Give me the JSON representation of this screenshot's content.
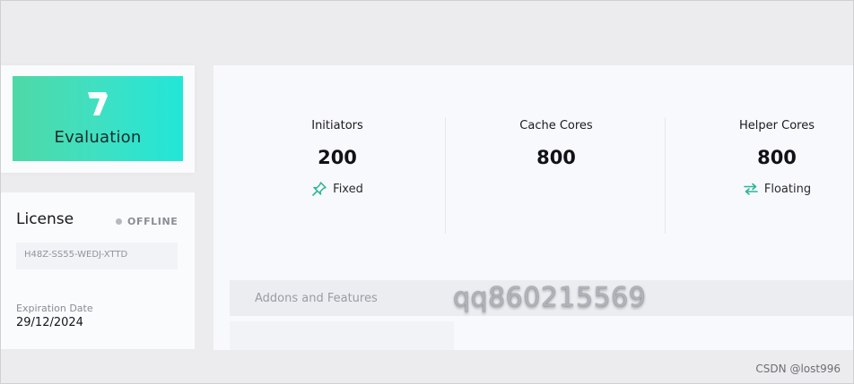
{
  "brand": {
    "title": "Evaluation",
    "logo_icon": "brand-logo-icon",
    "gradient": [
      "#4fd8a6",
      "#22e6d8"
    ]
  },
  "license": {
    "title": "License",
    "status": "OFFLINE",
    "key": "H48Z-SS55-WEDJ-XTTD",
    "expiration_label": "Expiration Date",
    "expiration_value": "29/12/2024"
  },
  "stats": [
    {
      "label": "Initiators",
      "value": "200",
      "tag": "Fixed",
      "tag_icon": "pin-icon"
    },
    {
      "label": "Cache Cores",
      "value": "800",
      "tag": "",
      "tag_icon": ""
    },
    {
      "label": "Helper Cores",
      "value": "800",
      "tag": "Floating",
      "tag_icon": "swap-arrows-icon"
    }
  ],
  "addons": {
    "title": "Addons and Features"
  },
  "overlay": {
    "watermark": "qq860215569",
    "credit": "CSDN @lost996"
  },
  "colors": {
    "accent": "#2bb596",
    "status_dot": "#b7b9bf"
  }
}
